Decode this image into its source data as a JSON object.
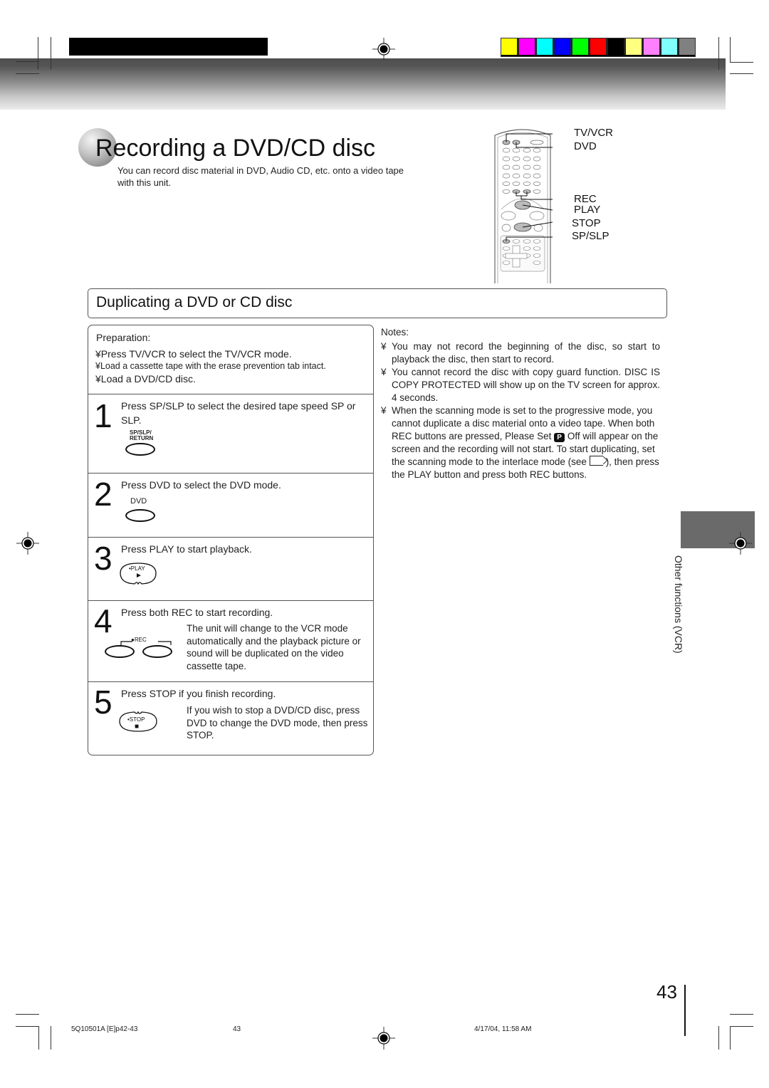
{
  "header": {
    "color_strip": [
      "#ffff00",
      "#ff00ff",
      "#00ffff",
      "#0000ff",
      "#00ff00",
      "#ff0000",
      "#000000",
      "#ffff80",
      "#ff80ff",
      "#80ffff",
      "#808080"
    ]
  },
  "page": {
    "title": "Recording a DVD/CD disc",
    "intro": "You can record disc material in DVD, Audio CD, etc. onto a video tape with this unit."
  },
  "remote_diagram": {
    "labels": [
      "TV/VCR",
      "DVD",
      "REC",
      "PLAY",
      "STOP",
      "SP/SLP"
    ]
  },
  "section": {
    "title": "Duplicating a DVD or CD disc"
  },
  "preparation": {
    "title": "Preparation:",
    "bullet": "¥",
    "items": [
      "Press TV/VCR to select the TV/VCR mode.",
      "Load a cassette tape with the erase prevention tab intact.",
      "Load a DVD/CD disc."
    ]
  },
  "steps": [
    {
      "number": "1",
      "text": "Press SP/SLP to select the desired tape speed SP or SLP.",
      "button_label_line1": "SP/SLP/",
      "button_label_line2": "RETURN"
    },
    {
      "number": "2",
      "text": "Press DVD to select the DVD mode.",
      "button_label": "DVD"
    },
    {
      "number": "3",
      "text": "Press PLAY to start playback.",
      "button_label": "•PLAY",
      "button_symbol": "►"
    },
    {
      "number": "4",
      "text": "Press both REC to start recording.",
      "button_label": "●REC",
      "note": "The unit will change to the VCR mode automatically and the playback picture or sound will be duplicated on the video cassette tape."
    },
    {
      "number": "5",
      "text": "Press STOP if you finish recording.",
      "button_label": "•STOP",
      "button_symbol": "■",
      "note": "If you wish to stop a DVD/CD disc, press DVD to change the DVD mode, then press STOP."
    }
  ],
  "notes": {
    "title": "Notes:",
    "bullet": "¥",
    "items": [
      {
        "text": "You may not record the beginning of the disc, so start to playback the disc, then start to record."
      },
      {
        "text": "You cannot record the disc with copy guard function.  DISC IS COPY PROTECTED  will show up on the TV screen for approx. 4 seconds."
      },
      {
        "text_a": "When the scanning mode is set to the progressive mode, you cannot duplicate a disc material onto a video tape. When both REC buttons are pressed,  Please Set",
        "p_icon": "P",
        "text_b": "Off will appear on the screen and the recording will not start. To start duplicating, set the scanning mode to the interlace mode (see",
        "text_c": "), then press the PLAY button and press both REC buttons."
      }
    ]
  },
  "side_tab": {
    "label": "Other functions (VCR)"
  },
  "page_number": "43",
  "footer": {
    "file": "5Q10501A [E]p42-43",
    "page": "43",
    "timestamp": "4/17/04, 11:58 AM"
  }
}
